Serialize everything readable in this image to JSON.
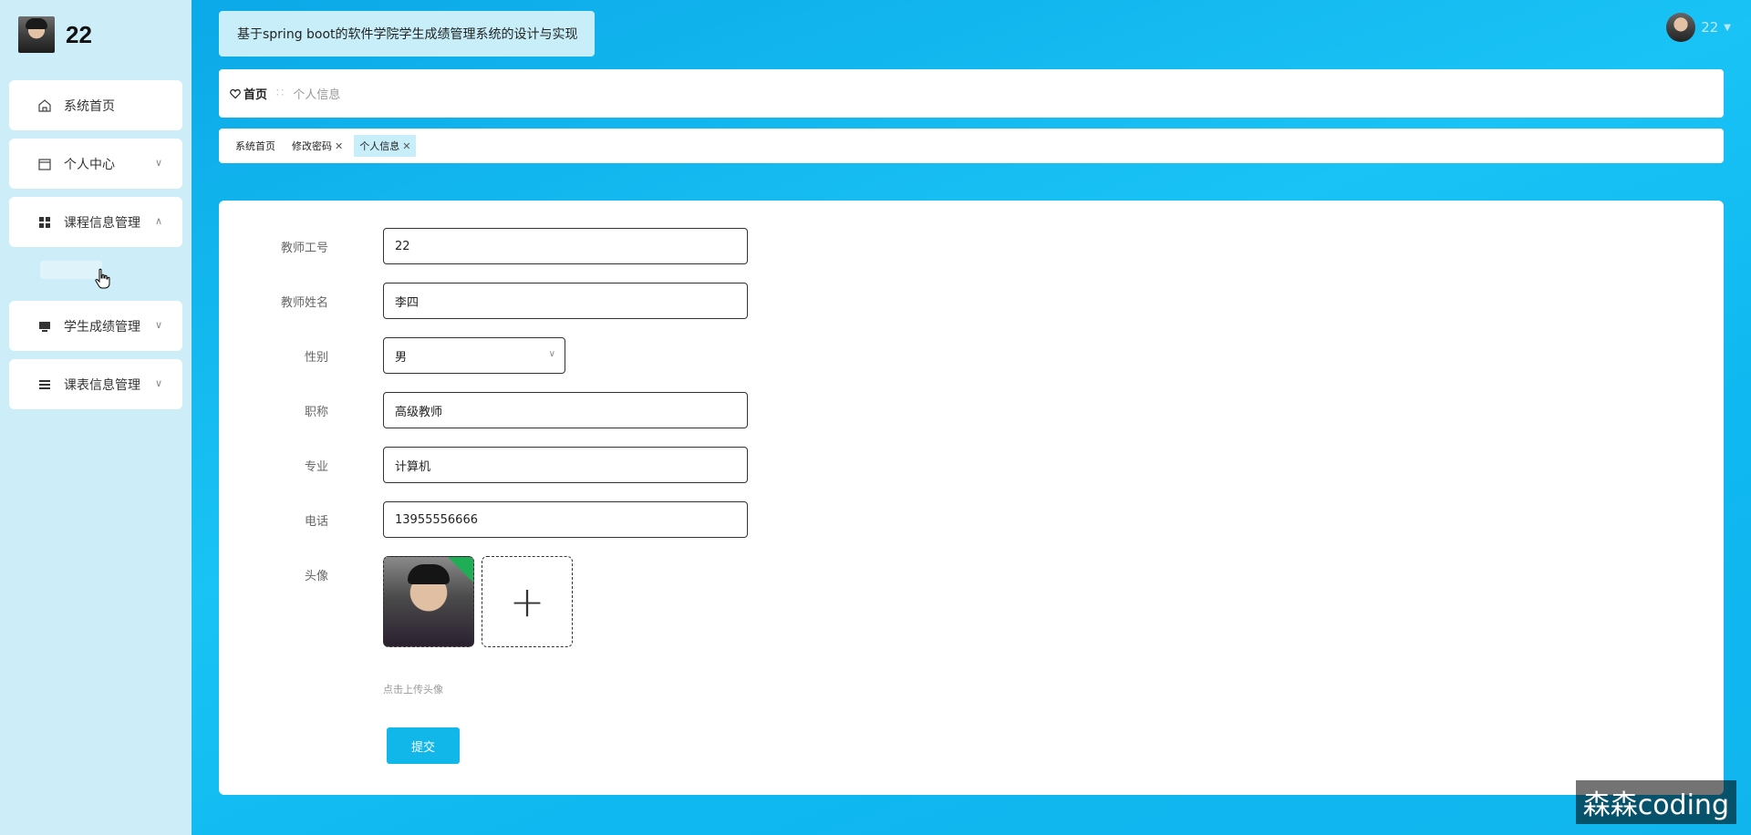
{
  "app": {
    "user_name": "22",
    "title": "基于spring boot的软件学院学生成绩管理系统的设计与实现"
  },
  "sidebar": {
    "items": [
      {
        "label": "系统首页",
        "icon": "home-icon"
      },
      {
        "label": "个人中心",
        "icon": "calendar-icon"
      },
      {
        "label": "课程信息管理",
        "icon": "grid-icon"
      },
      {
        "label": "学生成绩管理",
        "icon": "monitor-icon"
      },
      {
        "label": "课表信息管理",
        "icon": "list-icon"
      }
    ]
  },
  "header": {
    "user_label": "22"
  },
  "breadcrumb": {
    "home": "首页",
    "current": "个人信息"
  },
  "tabs": [
    {
      "label": "系统首页"
    },
    {
      "label": "修改密码"
    },
    {
      "label": "个人信息"
    }
  ],
  "form": {
    "fields": [
      {
        "label": "教师工号",
        "value": "22"
      },
      {
        "label": "教师姓名",
        "value": "李四"
      },
      {
        "label": "性别",
        "value": "男"
      },
      {
        "label": "职称",
        "value": "高级教师"
      },
      {
        "label": "专业",
        "value": "计算机"
      },
      {
        "label": "电话",
        "value": "13955556666"
      }
    ],
    "avatar_label": "头像",
    "upload_hint": "点击上传头像",
    "submit_label": "提交"
  },
  "watermark": "森森coding",
  "colors": {
    "accent": "#12b7ea",
    "sidebar_bg": "#cdeef8",
    "tab_active": "#c8eff9"
  }
}
